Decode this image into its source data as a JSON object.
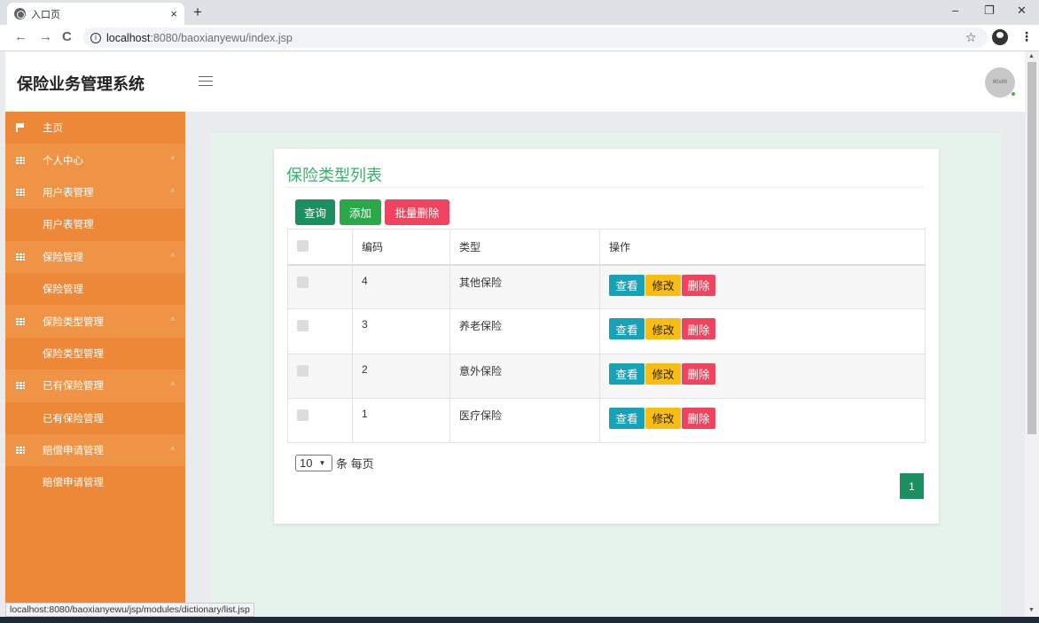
{
  "browser": {
    "tab_title": "入口页",
    "tab_close": "×",
    "new_tab": "+",
    "url_host": "localhost",
    "url_rest": ":8080/baoxianyewu/index.jsp",
    "window_controls": {
      "minimize": "–",
      "restore": "❐",
      "close": "✕"
    },
    "back": "←",
    "forward": "→",
    "reload": "C",
    "star": "☆",
    "menu": "⋮"
  },
  "header": {
    "app_title": "保险业务管理系统",
    "avatar_text": "80x80"
  },
  "sidebar": {
    "home": "主页",
    "items": [
      {
        "label": "个人中心",
        "chevron": "˅"
      },
      {
        "label": "用户表管理",
        "chevron": "˄",
        "sub": "用户表管理"
      },
      {
        "label": "保险管理",
        "chevron": "˄",
        "sub": "保险管理"
      },
      {
        "label": "保险类型管理",
        "chevron": "˄",
        "sub": "保险类型管理"
      },
      {
        "label": "已有保险管理",
        "chevron": "˄",
        "sub": "已有保险管理"
      },
      {
        "label": "赔偿申请管理",
        "chevron": "˄",
        "sub": "赔偿申请管理"
      }
    ]
  },
  "main": {
    "title": "保险类型列表",
    "buttons": {
      "query": "查询",
      "add": "添加",
      "batch_delete": "批量删除"
    },
    "table": {
      "headers": {
        "code": "编码",
        "type": "类型",
        "actions": "操作"
      },
      "rows": [
        {
          "code": "4",
          "type": "其他保险"
        },
        {
          "code": "3",
          "type": "养老保险"
        },
        {
          "code": "2",
          "type": "意外保险"
        },
        {
          "code": "1",
          "type": "医疗保险"
        }
      ],
      "row_actions": {
        "view": "查看",
        "edit": "修改",
        "delete": "删除"
      }
    },
    "pager": {
      "page_size": "10",
      "per_page_label": "条 每页",
      "current_page": "1"
    }
  },
  "status_url": "localhost:8080/baoxianyewu/jsp/modules/dictionary/list.jsp",
  "colors": {
    "sidebar": "#ec8838",
    "title_green": "#3cae6b",
    "primary_green": "#1a8f5f",
    "danger": "#f0445e",
    "info": "#17a2b8",
    "warning": "#f7bd12"
  }
}
